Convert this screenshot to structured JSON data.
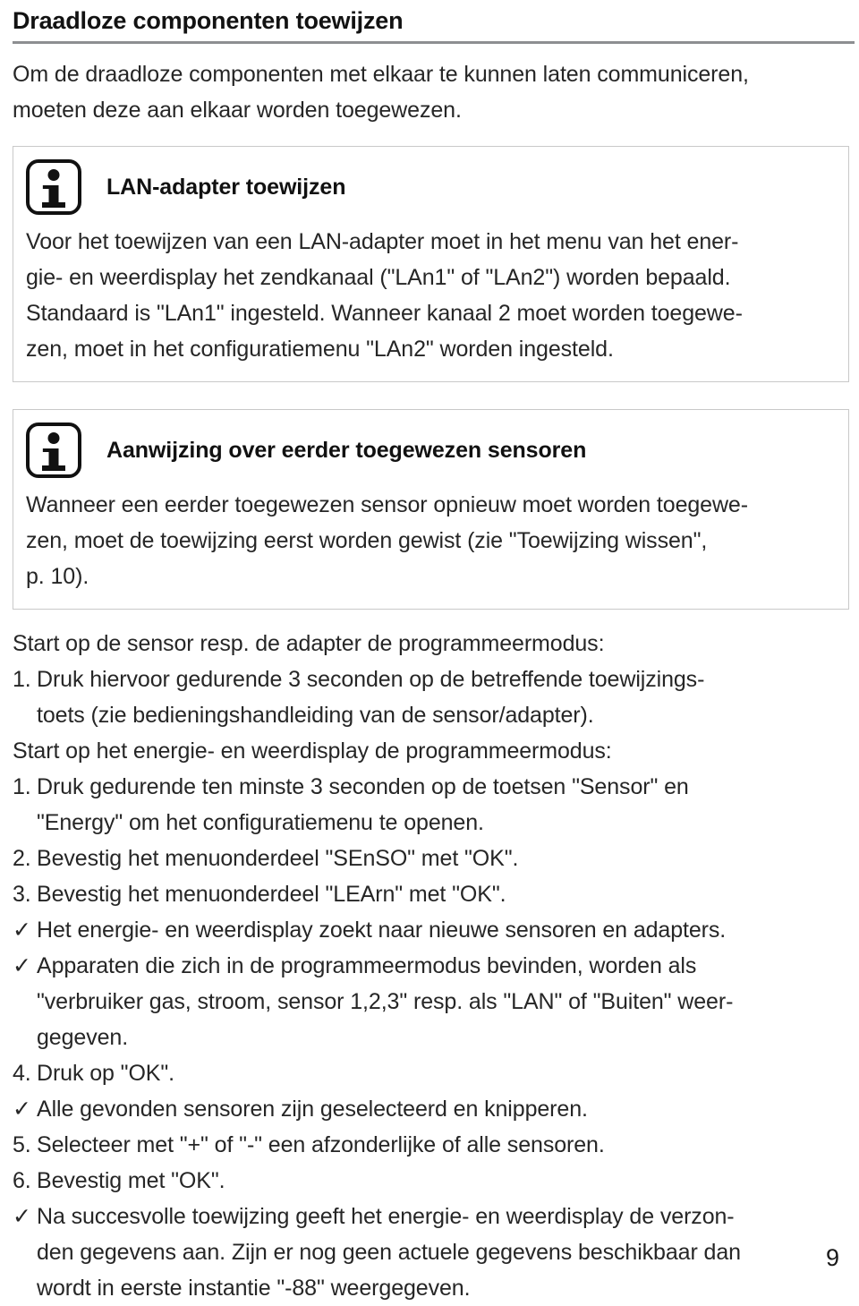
{
  "document": {
    "title": "Draadloze componenten toewijzen",
    "intro_lines": [
      "Om de draadloze componenten met elkaar te kunnen laten communiceren,",
      "moeten deze aan elkaar worden toegewezen."
    ],
    "page_number": "9"
  },
  "info_box_1": {
    "icon": "info-icon",
    "title": "LAN-adapter toewijzen",
    "body_lines": [
      "Voor het toewijzen van een LAN-adapter moet in het menu van het ener-",
      "gie- en weerdisplay het zendkanaal (\"LAn1\" of \"LAn2\") worden bepaald.",
      "Standaard is \"LAn1\" ingesteld. Wanneer kanaal 2 moet worden toegewe-",
      "zen, moet in het configuratiemenu \"LAn2\" worden ingesteld."
    ]
  },
  "info_box_2": {
    "icon": "info-icon",
    "title": "Aanwijzing over eerder toegewezen sensoren",
    "body_lines": [
      "Wanneer een eerder toegewezen sensor opnieuw moet worden toegewe-",
      "zen, moet de toewijzing eerst worden gewist (zie \"Toewijzing wissen\",",
      "p. 10)."
    ]
  },
  "procedure": {
    "lead_1": "Start op de sensor resp. de adapter de programmeermodus:",
    "steps_1": [
      {
        "marker": "1.",
        "type": "number",
        "lines": [
          "Druk hiervoor gedurende 3 seconden op de betreffende toewijzings-",
          "toets (zie bedieningshandleiding van de sensor/adapter)."
        ]
      }
    ],
    "lead_2": "Start op het energie- en weerdisplay de programmeermodus:",
    "steps_2": [
      {
        "marker": "1.",
        "type": "number",
        "lines": [
          "Druk gedurende ten minste 3 seconden op de toetsen \"Sensor\" en",
          "\"Energy\" om het configuratiemenu te openen."
        ]
      },
      {
        "marker": "2.",
        "type": "number",
        "lines": [
          "Bevestig het menuonderdeel \"SEnSO\" met \"OK\"."
        ]
      },
      {
        "marker": "3.",
        "type": "number",
        "lines": [
          "Bevestig het menuonderdeel \"LEArn\" met \"OK\"."
        ]
      },
      {
        "marker": "✓",
        "type": "check",
        "lines": [
          "Het energie- en weerdisplay zoekt naar nieuwe sensoren en adapters."
        ]
      },
      {
        "marker": "✓",
        "type": "check",
        "lines": [
          "Apparaten die zich in de programmeermodus bevinden, worden als",
          "\"verbruiker gas, stroom, sensor 1,2,3\" resp. als \"LAN\" of \"Buiten\" weer-",
          "gegeven."
        ]
      },
      {
        "marker": "4.",
        "type": "number",
        "lines": [
          "Druk op \"OK\"."
        ]
      },
      {
        "marker": "✓",
        "type": "check",
        "lines": [
          "Alle gevonden sensoren zijn geselecteerd en knipperen."
        ]
      },
      {
        "marker": "5.",
        "type": "number",
        "lines": [
          "Selecteer met \"+\" of \"-\" een afzonderlijke of alle sensoren."
        ]
      },
      {
        "marker": "6.",
        "type": "number",
        "lines": [
          "Bevestig met \"OK\"."
        ]
      },
      {
        "marker": "✓",
        "type": "check",
        "lines": [
          "Na succesvolle toewijzing geeft het energie- en weerdisplay de verzon-",
          "den gegevens aan. Zijn er nog geen actuele gegevens beschikbaar dan",
          "wordt in eerste instantie \"-88\" weergegeven."
        ]
      }
    ]
  },
  "colors": {
    "text": "#262626",
    "heading": "#121212",
    "rule": "#8d8f91",
    "box_border": "#c9c9c9"
  }
}
